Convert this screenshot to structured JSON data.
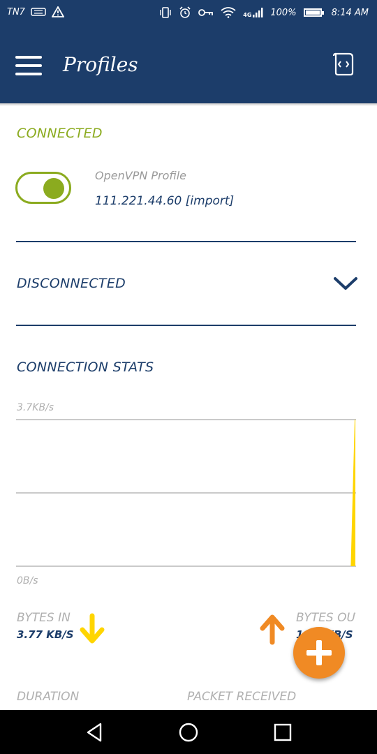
{
  "status_bar": {
    "carrier": "TN7",
    "battery_percent": "100%",
    "time": "8:14 AM",
    "network": "4G",
    "icons": [
      "sim-icon",
      "warning-icon",
      "vibrate-icon",
      "alarm-icon",
      "vpn-key-icon",
      "wifi-icon",
      "signal-icon",
      "battery-icon"
    ]
  },
  "app_bar": {
    "title": "Profiles",
    "menu_icon": "hamburger-menu-icon",
    "action_icon": "code-file-icon"
  },
  "connected_section": {
    "label": "CONNECTED",
    "toggle_on": true,
    "profile_name": "OpenVPN Profile",
    "profile_address": "111.221.44.60 [import]"
  },
  "disconnected_section": {
    "label": "DISCONNECTED",
    "icon": "chevron-down-icon"
  },
  "stats": {
    "label": "CONNECTION STATS",
    "max_label": "3.7KB/s",
    "min_label": "0B/s",
    "bytes_in_label": "BYTES IN",
    "bytes_in_value": "3.77 KB/S",
    "bytes_out_label": "BYTES OUT",
    "bytes_out_value": "1.73 KB/S",
    "duration_label": "DURATION",
    "packet_received_label": "PACKET RECEIVED"
  },
  "chart_data": {
    "type": "area",
    "series": [
      {
        "values": [
          0,
          0,
          0,
          0,
          0,
          0,
          0,
          0,
          0,
          0,
          0,
          0,
          0,
          0,
          0,
          0,
          0,
          0,
          0,
          0,
          0,
          0,
          0,
          0,
          0,
          0,
          0,
          0,
          0,
          0,
          0,
          0,
          0,
          0,
          0,
          0,
          0,
          0,
          0,
          3.77
        ]
      }
    ],
    "ylim": [
      0,
      3.7
    ],
    "grid": true,
    "colors": {
      "fill": "#ffd500",
      "grid": "#b8b8b8"
    }
  },
  "colors": {
    "primary": "#1c3d6a",
    "connected": "#8bab1f",
    "accent_orange": "#f08a24",
    "accent_yellow": "#ffd500"
  },
  "fab": {
    "icon": "plus-icon"
  },
  "nav_bar": {
    "icons": [
      "back-icon",
      "home-icon",
      "recents-icon"
    ]
  }
}
